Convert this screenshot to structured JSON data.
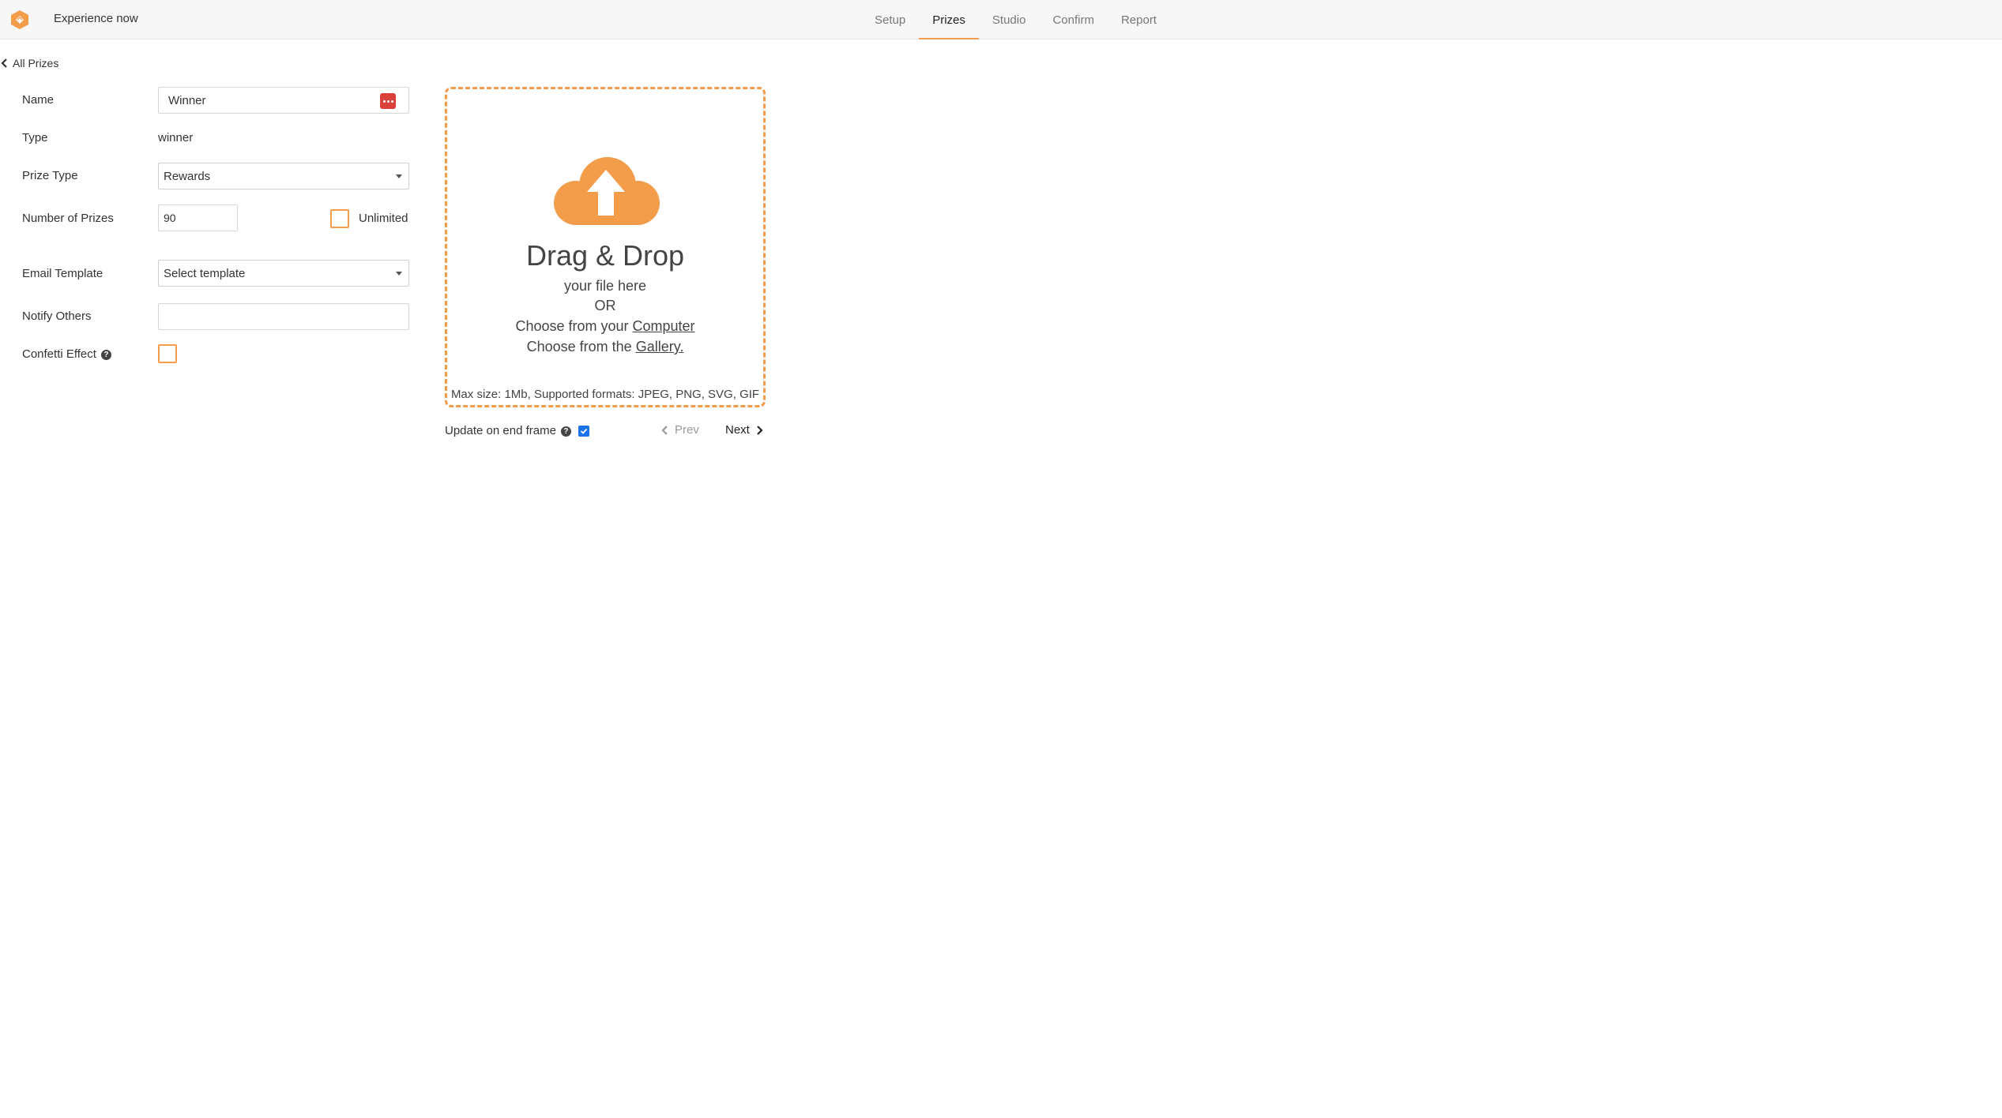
{
  "header": {
    "app_title": "Experience now",
    "tabs": [
      {
        "label": "Setup",
        "active": false
      },
      {
        "label": "Prizes",
        "active": true
      },
      {
        "label": "Studio",
        "active": false
      },
      {
        "label": "Confirm",
        "active": false
      },
      {
        "label": "Report",
        "active": false
      }
    ]
  },
  "back": {
    "label": "All Prizes"
  },
  "form": {
    "name": {
      "label": "Name",
      "value": "Winner"
    },
    "type": {
      "label": "Type",
      "value": "winner"
    },
    "prize_type": {
      "label": "Prize Type",
      "value": "Rewards"
    },
    "number_of_prizes": {
      "label": "Number of Prizes",
      "value": "90"
    },
    "unlimited": {
      "label": "Unlimited",
      "checked": false
    },
    "email_template": {
      "label": "Email Template",
      "value": "Select template"
    },
    "notify_others": {
      "label": "Notify Others",
      "value": ""
    },
    "confetti": {
      "label": "Confetti Effect",
      "checked": false
    }
  },
  "dropzone": {
    "title": "Drag & Drop",
    "line1": "your file here",
    "line2": "OR",
    "computer_prefix": "Choose from your ",
    "computer_link": "Computer",
    "gallery_prefix": "Choose from the ",
    "gallery_link": "Gallery.",
    "footer": "Max size: 1Mb, Supported formats: JPEG, PNG, SVG, GIF"
  },
  "controls": {
    "update_label": "Update on end frame",
    "update_checked": true,
    "prev_label": "Prev",
    "next_label": "Next"
  },
  "colors": {
    "accent": "#f39c4a",
    "danger": "#d9413a",
    "checkbox_blue": "#1a73e8"
  }
}
